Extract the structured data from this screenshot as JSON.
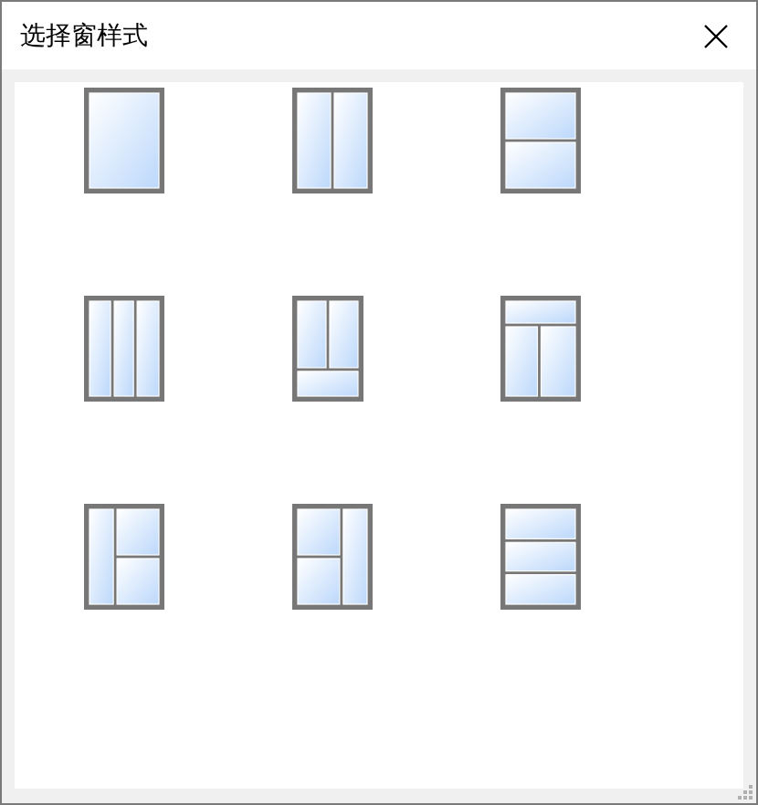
{
  "window": {
    "title": "选择窗样式"
  },
  "options": [
    {
      "kind": "single"
    },
    {
      "kind": "two-columns"
    },
    {
      "kind": "two-rows"
    },
    {
      "kind": "three-columns"
    },
    {
      "kind": "two-over-one"
    },
    {
      "kind": "one-over-two"
    },
    {
      "kind": "left-column-right-split"
    },
    {
      "kind": "left-split-right-column"
    },
    {
      "kind": "three-rows"
    }
  ]
}
